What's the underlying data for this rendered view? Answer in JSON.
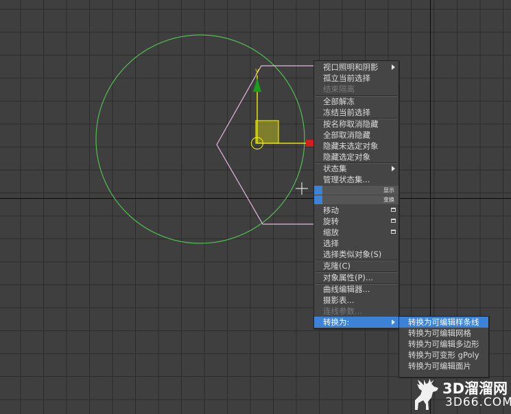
{
  "context_menu": {
    "items": [
      {
        "label": "视口照明和阴影",
        "submenu": true
      },
      {
        "label": "孤立当前选择"
      },
      {
        "label": "结束隔离",
        "disabled": true
      },
      {
        "label": "全部解冻"
      },
      {
        "label": "冻结当前选择"
      },
      {
        "label": "按名称取消隐藏"
      },
      {
        "label": "全部取消隐藏"
      },
      {
        "label": "隐藏未选定对象"
      },
      {
        "label": "隐藏选定对象"
      },
      {
        "label": "状态集",
        "submenu": true
      },
      {
        "label": "管理状态集..."
      },
      {
        "label": "移动",
        "box_icon": true
      },
      {
        "label": "旋转",
        "box_icon": true
      },
      {
        "label": "缩放",
        "box_icon": true
      },
      {
        "label": "选择"
      },
      {
        "label": "选择类似对象(S)"
      },
      {
        "label": "克隆(C)"
      },
      {
        "label": "对象属性(P)..."
      },
      {
        "label": "曲线编辑器..."
      },
      {
        "label": "摄影表..."
      },
      {
        "label": "连线参数...",
        "disabled": true
      },
      {
        "label": "转换为:",
        "submenu": true,
        "active": true
      }
    ],
    "quad_labels": {
      "display": "显示",
      "transform": "变换"
    }
  },
  "convert_submenu": {
    "items": [
      {
        "label": "转换为可编辑样条线",
        "active": true
      },
      {
        "label": "转换为可编辑网格"
      },
      {
        "label": "转换为可编辑多边形"
      },
      {
        "label": "转换为可变形 gPoly"
      },
      {
        "label": "转换为可编辑面片"
      }
    ]
  },
  "gizmo": {
    "axis_y_label": "y"
  },
  "watermark": {
    "brand": "3D溜溜网",
    "url": "3D66.COM"
  },
  "colors": {
    "viewport_bg": "#3f3f3f",
    "grid_line": "#2b2b2b",
    "circle": "#4ec24e",
    "shape_selected": "#e6b8e0",
    "gizmo_y": "#e6e600",
    "gizmo_x_handle": "#d02020",
    "gizmo_arrow": "#19a019",
    "menu_highlight": "#3c82d6"
  }
}
